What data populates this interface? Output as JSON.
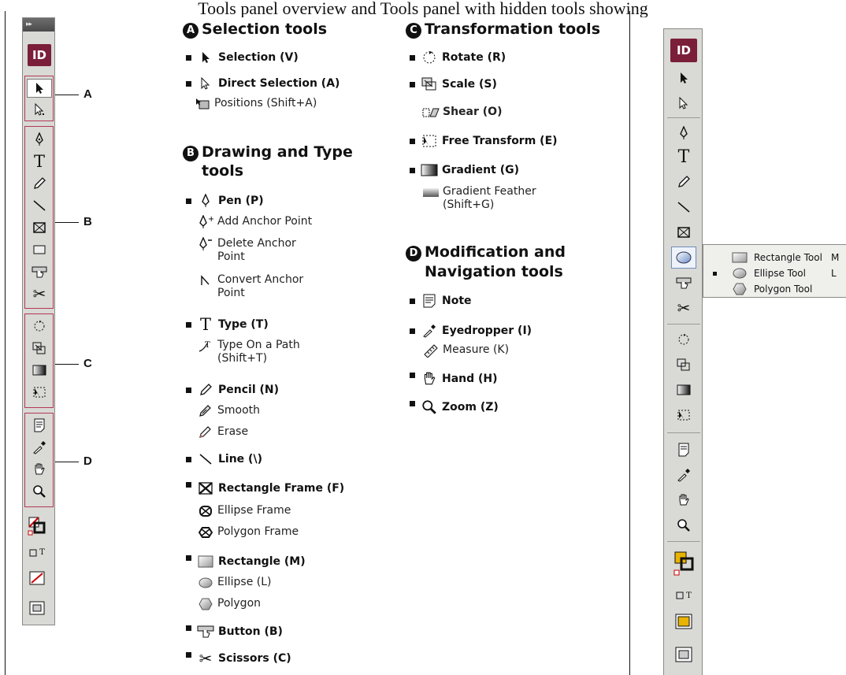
{
  "header_text": "Tools panel overview and Tools panel with hidden tools showing",
  "toolbox": {
    "collapse_glyph": "▸▸",
    "logo": "ID",
    "callouts": [
      "A",
      "B",
      "C",
      "D"
    ],
    "type_mode_label": "T"
  },
  "sections": {
    "selection": {
      "badge": "A",
      "title": "Selection tools"
    },
    "drawing": {
      "badge": "B",
      "title_line1": "Drawing and Type",
      "title_line2": "tools"
    },
    "transformation": {
      "badge": "C",
      "title": "Transformation tools"
    },
    "modification": {
      "badge": "D",
      "title_line1": "Modification and",
      "title_line2": "Navigation tools"
    }
  },
  "selection_tools": [
    {
      "label": "Selection (V)",
      "icon": "selection-arrow-icon",
      "bold": true
    },
    {
      "label": "Direct Selection (A)",
      "icon": "direct-selection-arrow-icon",
      "bold": true
    },
    {
      "label": "Positions (Shift+A)",
      "icon": "position-icon",
      "bold": false
    }
  ],
  "drawing_tools": {
    "pen": "Pen (P)",
    "add_anchor": "Add Anchor Point",
    "delete_anchor": "Delete Anchor\nPoint",
    "convert_anchor": "Convert Anchor\nPoint",
    "type": "Type (T)",
    "type_on_path": "Type On a Path\n(Shift+T)",
    "pencil": "Pencil (N)",
    "smooth": "Smooth",
    "erase": "Erase",
    "line": "Line (\\)",
    "rect_frame": "Rectangle Frame (F)",
    "ellipse_frame": "Ellipse Frame",
    "polygon_frame": "Polygon Frame",
    "rectangle": "Rectangle (M)",
    "ellipse": "Ellipse (L)",
    "polygon": "Polygon",
    "button": "Button (B)",
    "scissors": "Scissors (C)"
  },
  "transformation_tools": {
    "rotate": "Rotate (R)",
    "scale": "Scale (S)",
    "shear": "Shear (O)",
    "free_transform": "Free Transform (E)",
    "gradient": "Gradient (G)",
    "gradient_feather": "Gradient Feather\n(Shift+G)"
  },
  "modification_tools": {
    "note": "Note",
    "eyedropper": "Eyedropper (I)",
    "measure": "Measure (K)",
    "hand": "Hand (H)",
    "zoom": "Zoom (Z)"
  },
  "right_toolbox": {
    "logo": "ID",
    "type_mode_label": "T",
    "flyout": [
      {
        "label": "Rectangle Tool",
        "key": "M",
        "selected": false
      },
      {
        "label": "Ellipse Tool",
        "key": "L",
        "selected": true
      },
      {
        "label": "Polygon Tool",
        "key": "",
        "selected": false
      }
    ]
  },
  "colors": {
    "logo": "#7a1e3a",
    "panel": "#d9d9d5",
    "group_outline": "#b23a55",
    "fill_swatch": "#e8b400"
  }
}
